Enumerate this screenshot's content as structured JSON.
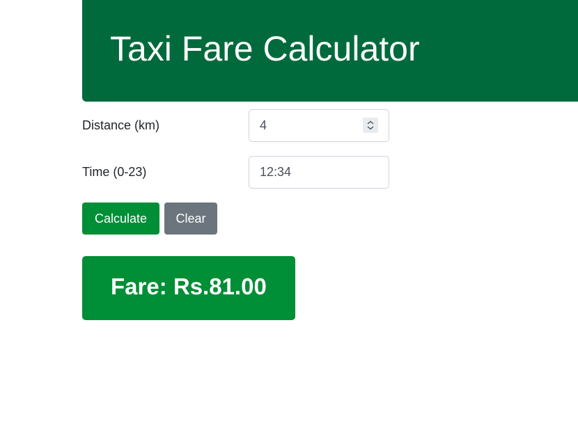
{
  "header": {
    "title": "Taxi Fare Calculator"
  },
  "form": {
    "distance": {
      "label": "Distance (km)",
      "value": "4"
    },
    "time": {
      "label": "Time (0-23)",
      "value": "12:34"
    }
  },
  "buttons": {
    "calculate_label": "Calculate",
    "clear_label": "Clear"
  },
  "result": {
    "text": "Fare: Rs.81.00"
  },
  "colors": {
    "header_bg": "#006a3c",
    "primary_button": "#008e36",
    "secondary_button": "#6c757d",
    "result_bg": "#008e36"
  },
  "icons": {
    "spinner": "up-down-spinner-icon"
  }
}
